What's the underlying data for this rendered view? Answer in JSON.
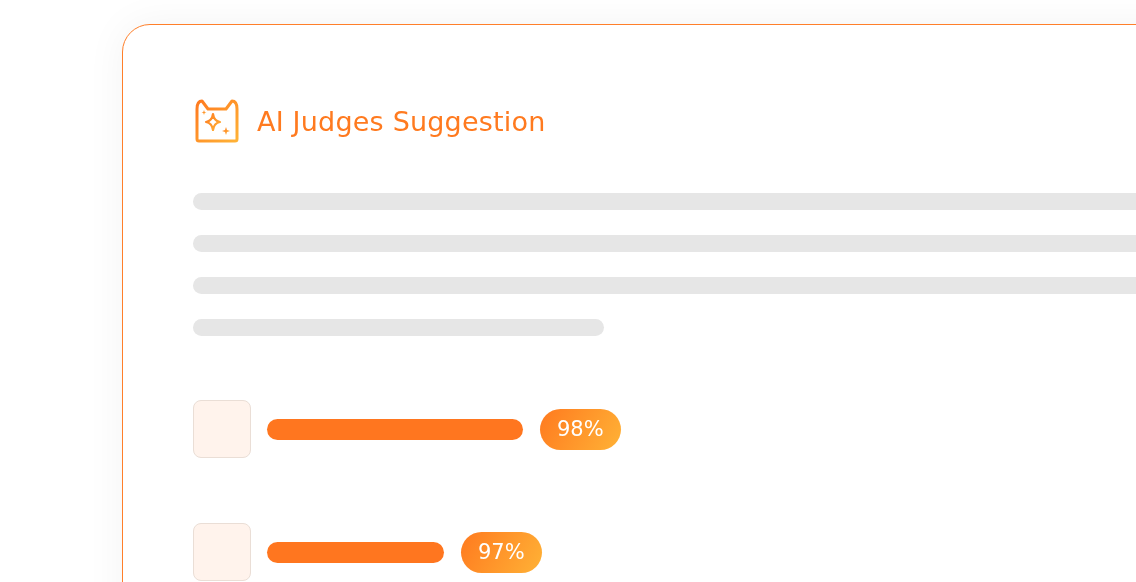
{
  "card": {
    "title": "AI Judges Suggestion"
  },
  "suggestions": [
    {
      "score": "98%"
    },
    {
      "score": "97%"
    }
  ]
}
